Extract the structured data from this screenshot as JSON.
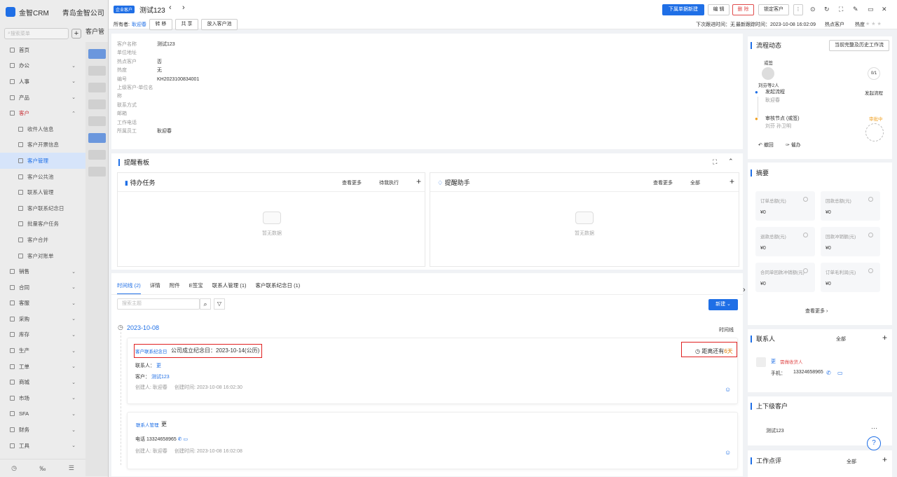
{
  "sidebar": {
    "app": "金智CRM",
    "company": "青岛金智公司",
    "search_placeholder": "搜索菜单",
    "tab": "客户管",
    "items": [
      {
        "label": "首页"
      },
      {
        "label": "办公",
        "chev": "⌄"
      },
      {
        "label": "人事",
        "chev": "⌄"
      },
      {
        "label": "产品",
        "chev": "⌄"
      },
      {
        "label": "客户",
        "chev": "⌃"
      },
      {
        "label": "收件人信息",
        "sub": true
      },
      {
        "label": "客户开票信息",
        "sub": true
      },
      {
        "label": "客户管理",
        "sub": true,
        "active": true
      },
      {
        "label": "客户公共池",
        "sub": true
      },
      {
        "label": "联系人管理",
        "sub": true
      },
      {
        "label": "客户联系纪念日",
        "sub": true
      },
      {
        "label": "批量客户任务",
        "sub": true
      },
      {
        "label": "客户合并",
        "sub": true
      },
      {
        "label": "客户对账单",
        "sub": true
      },
      {
        "label": "销售",
        "chev": "⌄"
      },
      {
        "label": "合同",
        "chev": "⌄"
      },
      {
        "label": "客服",
        "chev": "⌄"
      },
      {
        "label": "采购",
        "chev": "⌄"
      },
      {
        "label": "库存",
        "chev": "⌄"
      },
      {
        "label": "生产",
        "chev": "⌄"
      },
      {
        "label": "工单",
        "chev": "⌄"
      },
      {
        "label": "商城",
        "chev": "⌄"
      },
      {
        "label": "市场",
        "chev": "⌄"
      },
      {
        "label": "SFA",
        "chev": "⌄"
      },
      {
        "label": "财务",
        "chev": "⌄"
      },
      {
        "label": "工具",
        "chev": "⌄"
      }
    ]
  },
  "header": {
    "badge": "企业客户",
    "title": "测试123",
    "owner_label": "所有者:",
    "owner": "耿迎春",
    "actions": [
      "转 移",
      "共 享",
      "放入客户池"
    ],
    "buttons": {
      "new_order": "下属单据新建",
      "edit": "编 辑",
      "delete": "删 除",
      "lock": "锁定客户"
    },
    "next_time": "下次跟进时间：无",
    "last_time": "最新跟踪时间：2023-10-08 16:02:09",
    "hot": "热点客户",
    "hot2": "热度"
  },
  "info": [
    {
      "k": "客户名称",
      "v": "测试123"
    },
    {
      "k": "单位地址",
      "v": ""
    },
    {
      "k": "热点客户",
      "v": "否"
    },
    {
      "k": "热度",
      "v": "无"
    },
    {
      "k": "编号",
      "v": "KH2023100834001"
    },
    {
      "k": "上级客户-单位名称",
      "v": ""
    },
    {
      "k": "联系方式",
      "v": ""
    },
    {
      "k": "邮箱",
      "v": ""
    },
    {
      "k": "工作电话",
      "v": ""
    },
    {
      "k": "所属员工",
      "v": "耿迎春"
    }
  ],
  "reminder": {
    "title": "提醒看板",
    "todo": {
      "title": "待办任务",
      "more": "查看更多",
      "filter": "待我执行",
      "empty": "暂无数据"
    },
    "assistant": {
      "title": "提醒助手",
      "more": "查看更多",
      "filter": "全部",
      "empty": "暂无数据"
    }
  },
  "timeline": {
    "tabs": [
      "时间线 (2)",
      "详情",
      "附件",
      "E签宝",
      "联系人管理 (1)",
      "客户联系纪念日 (1)"
    ],
    "search_placeholder": "搜索主题",
    "new_btn": "新建",
    "date": "2023-10-08",
    "label": "时间线",
    "card1": {
      "tag": "客户联系纪念日",
      "title": "公司成立纪念日：2023-10-14(公历)",
      "countdown": "距离还有",
      "days": "6天",
      "contact_label": "联系人：",
      "contact": "更",
      "customer_label": "客户：",
      "customer": "测试123",
      "creator": "创建人: 耿迎春",
      "created": "创建时间: 2023-10-08 16:02:30"
    },
    "card2": {
      "tag": "联系人管理",
      "name": "更",
      "phone": "电话 13324658965",
      "creator": "创建人: 耿迎春",
      "created": "创建时间: 2023-10-08 16:02:08"
    }
  },
  "flow": {
    "title": "流程动态",
    "btn": "当前完整及历史工作流",
    "sign": "或签",
    "people": "刘芬等2人",
    "count": "0/1",
    "start": "发起流程",
    "starter": "耿迎春",
    "start_right": "发起流程",
    "node": "审核节点 (或签)",
    "node_people": "刘芬 孙卫明",
    "status": "审批中",
    "revoke": "撤回",
    "urge": "催办"
  },
  "summary": {
    "title": "摘要",
    "stats": [
      {
        "l": "订单总额(元)",
        "v": "¥0"
      },
      {
        "l": "回款总额(元)",
        "v": "¥0"
      },
      {
        "l": "退款总额(元)",
        "v": "¥0"
      },
      {
        "l": "回款冲销额(元)",
        "v": "¥0"
      },
      {
        "l": "合同单回款冲销额(元)",
        "v": "¥0"
      },
      {
        "l": "订单毛利润(元)",
        "v": "¥0"
      }
    ],
    "more": "查看更多"
  },
  "contacts": {
    "title": "联系人",
    "filter": "全部",
    "name": "更",
    "tag": "需做收货人",
    "phone_label": "手机：",
    "phone": "13324658965"
  },
  "parent": {
    "title": "上下级客户",
    "item": "测试123"
  },
  "review": {
    "title": "工作点评",
    "filter": "全部"
  }
}
